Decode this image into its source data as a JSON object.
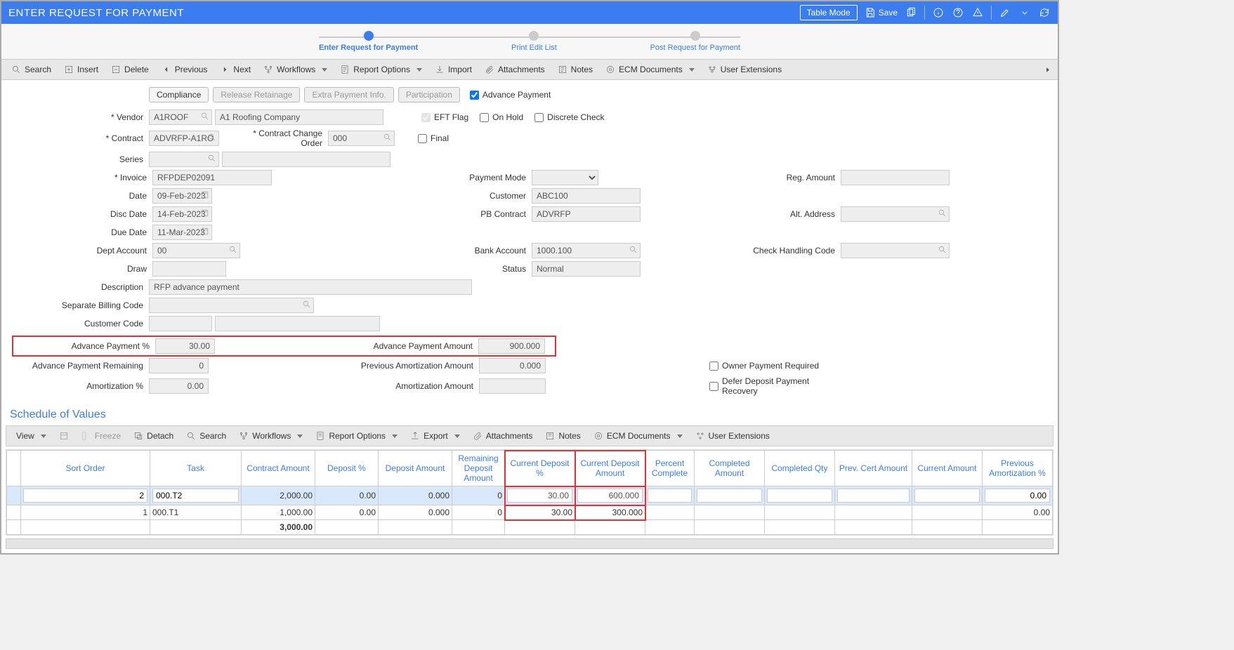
{
  "header": {
    "title": "ENTER REQUEST FOR PAYMENT",
    "table_mode": "Table Mode",
    "save": "Save"
  },
  "steps": {
    "s1": "Enter Request for Payment",
    "s2": "Print Edit List",
    "s3": "Post Request for Payment"
  },
  "toolbar": {
    "search": "Search",
    "insert": "Insert",
    "delete": "Delete",
    "previous": "Previous",
    "next": "Next",
    "workflows": "Workflows",
    "report_options": "Report Options",
    "import": "Import",
    "attachments": "Attachments",
    "notes": "Notes",
    "ecm": "ECM Documents",
    "user_ext": "User Extensions"
  },
  "tabs": {
    "compliance": "Compliance",
    "release_retainage": "Release Retainage",
    "extra_payment": "Extra Payment Info.",
    "participation": "Participation",
    "advance_payment": "Advance Payment"
  },
  "labels": {
    "vendor": "Vendor",
    "contract": "Contract",
    "series": "Series",
    "invoice": "Invoice",
    "date": "Date",
    "disc_date": "Disc Date",
    "due_date": "Due Date",
    "dept_account": "Dept Account",
    "draw": "Draw",
    "description": "Description",
    "sep_billing": "Separate Billing Code",
    "customer_code": "Customer Code",
    "adv_payment_pct": "Advance Payment %",
    "adv_payment_amt": "Advance Payment Amount",
    "adv_payment_rem": "Advance Payment Remaining",
    "prev_amort_amt": "Previous Amortization Amount",
    "amort_pct": "Amortization %",
    "amort_amt": "Amortization Amount",
    "cco": "Contract Change Order",
    "eft": "EFT Flag",
    "onhold": "On Hold",
    "discrete": "Discrete Check",
    "final": "Final",
    "payment_mode": "Payment Mode",
    "customer": "Customer",
    "pb_contract": "PB Contract",
    "bank_account": "Bank Account",
    "status": "Status",
    "reg_amount": "Reg. Amount",
    "alt_address": "Alt. Address",
    "check_handling": "Check Handling Code",
    "owner_pay": "Owner Payment Required",
    "defer_deposit": "Defer Deposit Payment Recovery"
  },
  "values": {
    "vendor": "A1ROOF",
    "vendor_name": "A1 Roofing Company",
    "contract": "ADVRFP-A1RO",
    "cco": "000",
    "invoice": "RFPDEP02091",
    "date": "09-Feb-2023",
    "disc_date": "14-Feb-2023",
    "due_date": "11-Mar-2023",
    "dept_account": "00",
    "customer": "ABC100",
    "pb_contract": "ADVRFP",
    "bank_account": "1000.100",
    "status": "Normal",
    "description": "RFP advance payment",
    "adv_pct": "30.00",
    "adv_amt": "900.000",
    "adv_rem": "0",
    "prev_amort": "0.000",
    "amort_pct": "0.00"
  },
  "sov": {
    "title": "Schedule of Values",
    "toolbar": {
      "view": "View",
      "freeze": "Freeze",
      "detach": "Detach",
      "search": "Search",
      "workflows": "Workflows",
      "report_options": "Report Options",
      "export": "Export",
      "attachments": "Attachments",
      "notes": "Notes",
      "ecm": "ECM Documents",
      "user_ext": "User Extensions"
    },
    "columns": {
      "sort": "Sort Order",
      "task": "Task",
      "contract_amt": "Contract Amount",
      "deposit_pct": "Deposit %",
      "deposit_amt": "Deposit Amount",
      "rem_deposit": "Remaining Deposit Amount",
      "cur_dep_pct": "Current Deposit %",
      "cur_dep_amt": "Current Deposit Amount",
      "pct_complete": "Percent Complete",
      "comp_amt": "Completed Amount",
      "comp_qty": "Completed Qty",
      "prev_cert": "Prev. Cert Amount",
      "cur_amt": "Current Amount",
      "prev_amort": "Previous Amortization %"
    },
    "rows": [
      {
        "sort": "2",
        "task": "000.T2",
        "ca": "2,000.00",
        "dp": "0.00",
        "da": "0.000",
        "rd": "0",
        "cdp": "30.00",
        "cda": "600.000",
        "pa": "0.00"
      },
      {
        "sort": "1",
        "task": "000.T1",
        "ca": "1,000.00",
        "dp": "0.00",
        "da": "0.000",
        "rd": "0",
        "cdp": "30.00",
        "cda": "300.000",
        "pa": "0.00"
      }
    ],
    "total_ca": "3,000.00"
  }
}
